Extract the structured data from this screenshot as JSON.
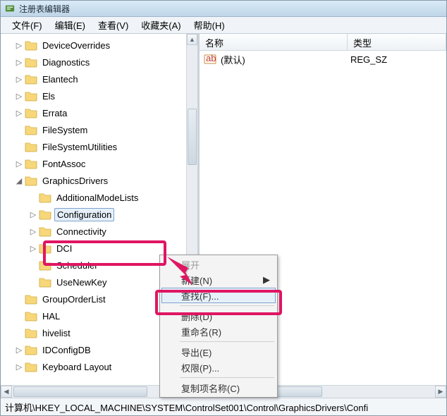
{
  "window": {
    "title": "注册表编辑器"
  },
  "menubar": {
    "file": "文件(F)",
    "edit": "编辑(E)",
    "view": "查看(V)",
    "favorites": "收藏夹(A)",
    "help": "帮助(H)"
  },
  "tree": {
    "items": [
      {
        "label": "DeviceOverrides",
        "indent": 1,
        "toggle": "▷"
      },
      {
        "label": "Diagnostics",
        "indent": 1,
        "toggle": "▷"
      },
      {
        "label": "Elantech",
        "indent": 1,
        "toggle": "▷"
      },
      {
        "label": "Els",
        "indent": 1,
        "toggle": "▷"
      },
      {
        "label": "Errata",
        "indent": 1,
        "toggle": "▷"
      },
      {
        "label": "FileSystem",
        "indent": 1,
        "toggle": ""
      },
      {
        "label": "FileSystemUtilities",
        "indent": 1,
        "toggle": ""
      },
      {
        "label": "FontAssoc",
        "indent": 1,
        "toggle": "▷"
      },
      {
        "label": "GraphicsDrivers",
        "indent": 1,
        "toggle": "◢"
      },
      {
        "label": "AdditionalModeLists",
        "indent": 2,
        "toggle": ""
      },
      {
        "label": "Configuration",
        "indent": 2,
        "toggle": "▷",
        "selected": true
      },
      {
        "label": "Connectivity",
        "indent": 2,
        "toggle": "▷"
      },
      {
        "label": "DCI",
        "indent": 2,
        "toggle": "▷"
      },
      {
        "label": "Scheduler",
        "indent": 2,
        "toggle": ""
      },
      {
        "label": "UseNewKey",
        "indent": 2,
        "toggle": ""
      },
      {
        "label": "GroupOrderList",
        "indent": 1,
        "toggle": ""
      },
      {
        "label": "HAL",
        "indent": 1,
        "toggle": ""
      },
      {
        "label": "hivelist",
        "indent": 1,
        "toggle": ""
      },
      {
        "label": "IDConfigDB",
        "indent": 1,
        "toggle": "▷"
      },
      {
        "label": "Keyboard Layout",
        "indent": 1,
        "toggle": "▷"
      }
    ]
  },
  "list": {
    "col_name": "名称",
    "col_type": "类型",
    "rows": [
      {
        "name": "(默认)",
        "type": "REG_SZ"
      }
    ]
  },
  "context": {
    "expand": "展开",
    "new": "新建(N)",
    "find": "查找(F)...",
    "delete": "删除(D)",
    "rename": "重命名(R)",
    "export": "导出(E)",
    "permissions": "权限(P)...",
    "copykeyname": "复制项名称(C)"
  },
  "statusbar": {
    "path": "计算机\\HKEY_LOCAL_MACHINE\\SYSTEM\\ControlSet001\\Control\\GraphicsDrivers\\Confi"
  }
}
